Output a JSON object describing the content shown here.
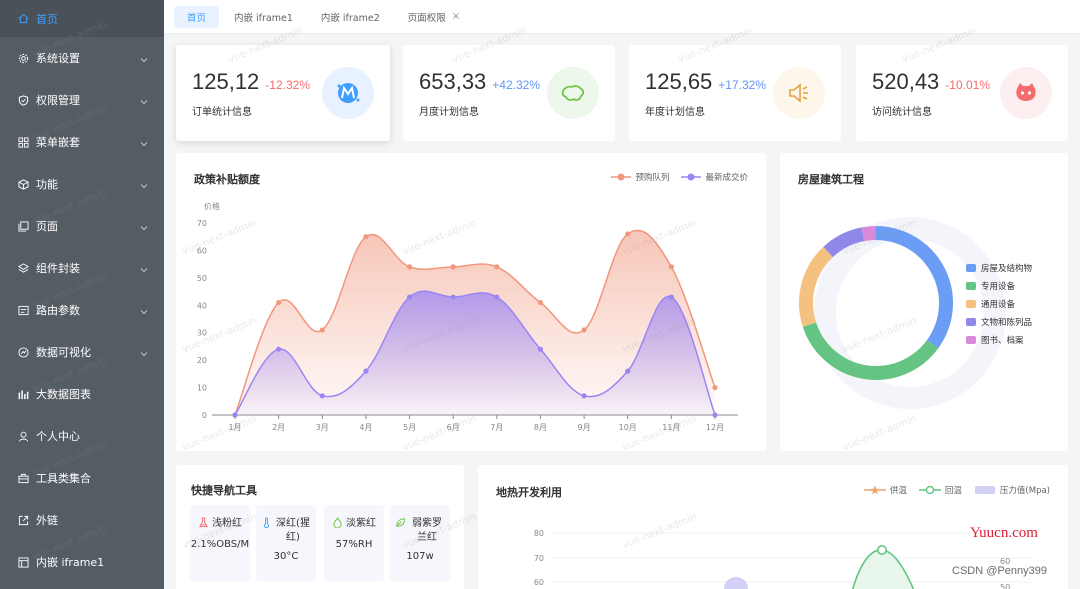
{
  "sidebar": {
    "items": [
      {
        "label": "首页",
        "icon": "home-icon",
        "active": true
      },
      {
        "label": "系统设置",
        "icon": "gear-icon",
        "caret": true
      },
      {
        "label": "权限管理",
        "icon": "shield-icon",
        "caret": true
      },
      {
        "label": "菜单嵌套",
        "icon": "grid-icon",
        "caret": true
      },
      {
        "label": "功能",
        "icon": "cube-icon",
        "caret": true
      },
      {
        "label": "页面",
        "icon": "page-icon",
        "caret": true
      },
      {
        "label": "组件封装",
        "icon": "components-icon",
        "caret": true
      },
      {
        "label": "路由参数",
        "icon": "route-icon",
        "caret": true
      },
      {
        "label": "数据可视化",
        "icon": "chart-icon",
        "caret": true
      },
      {
        "label": "大数据图表",
        "icon": "bar-chart-icon"
      },
      {
        "label": "个人中心",
        "icon": "user-icon"
      },
      {
        "label": "工具类集合",
        "icon": "toolbox-icon"
      },
      {
        "label": "外链",
        "icon": "external-link-icon"
      },
      {
        "label": "内嵌 iframe1",
        "icon": "iframe-icon"
      }
    ]
  },
  "tabs": [
    {
      "label": "首页",
      "active": true
    },
    {
      "label": "内嵌 iframe1"
    },
    {
      "label": "内嵌 iframe2"
    },
    {
      "label": "页面权限",
      "closable": true,
      "close_label": "×"
    }
  ],
  "stats": [
    {
      "value": "125,12",
      "pct": "-12.32%",
      "label": "订单统计信息",
      "pct_color": "#f56c6c",
      "icon": "m-logo-icon",
      "circle_color": "#e8f1ff",
      "icon_color": "#409eff"
    },
    {
      "value": "653,33",
      "pct": "+42.32%",
      "label": "月度计划信息",
      "pct_color": "#6394f9",
      "icon": "map-icon",
      "circle_color": "#edf7ec",
      "icon_color": "#67c23a"
    },
    {
      "value": "125,65",
      "pct": "+17.32%",
      "label": "年度计划信息",
      "pct_color": "#6394f9",
      "icon": "speaker-icon",
      "circle_color": "#fdf6ea",
      "icon_color": "#e6a23c"
    },
    {
      "value": "520,43",
      "pct": "-10.01%",
      "label": "访问统计信息",
      "pct_color": "#f56c6c",
      "icon": "octocat-icon",
      "circle_color": "#fdefef",
      "icon_color": "#f56c6c"
    }
  ],
  "subsidy": {
    "title": "政策补贴额度"
  },
  "housing": {
    "title": "房屋建筑工程"
  },
  "quicknav": {
    "title": "快捷导航工具",
    "items": [
      {
        "label": "浅粉红",
        "value": "2.1%OBS/M",
        "icon": "flask-icon",
        "color": "#f56c6c"
      },
      {
        "label": "深红(猩红)",
        "value": "30°C",
        "icon": "thermometer-icon",
        "color": "#409eff"
      },
      {
        "label": "淡紫红",
        "value": "57%RH",
        "icon": "droplet-icon",
        "color": "#67c23a"
      },
      {
        "label": "弱紫罗兰红",
        "value": "107w",
        "icon": "leaf-icon",
        "color": "#67c23a"
      }
    ]
  },
  "geothermal": {
    "title": "地热开发利用"
  },
  "watermark": "vue-next-admin",
  "corner": {
    "yuucn": "Yuucn.com",
    "csdn": "CSDN @Penny399"
  },
  "chart_data": [
    {
      "type": "area",
      "title": "政策补贴额度",
      "ylabel": "价格",
      "categories": [
        "1月",
        "2月",
        "3月",
        "4月",
        "5月",
        "6月",
        "7月",
        "8月",
        "9月",
        "10月",
        "11月",
        "12月"
      ],
      "ylim": [
        0,
        70
      ],
      "yticks": [
        0,
        10,
        20,
        30,
        40,
        50,
        60,
        70
      ],
      "legend_position": "top-right",
      "series": [
        {
          "name": "预购队列",
          "color": "#f0977d",
          "values": [
            0,
            41,
            31,
            65,
            54,
            54,
            54,
            41,
            31,
            66,
            54,
            10
          ]
        },
        {
          "name": "最新成交价",
          "color": "#9b85f4",
          "values": [
            0,
            24,
            7,
            16,
            43,
            43,
            43,
            24,
            7,
            16,
            43,
            0
          ]
        }
      ]
    },
    {
      "type": "pie",
      "title": "房屋建筑工程",
      "legend_position": "right",
      "slices": [
        {
          "name": "房屋及结构物",
          "value": 35,
          "color": "#6c9df5"
        },
        {
          "name": "专用设备",
          "value": 35,
          "color": "#65c483"
        },
        {
          "name": "通用设备",
          "value": 18,
          "color": "#f3c281"
        },
        {
          "name": "文物和陈列品",
          "value": 9,
          "color": "#9088e9"
        },
        {
          "name": "图书、档案",
          "value": 3,
          "color": "#d88ad9"
        }
      ]
    },
    {
      "type": "line",
      "title": "地热开发利用",
      "legend_position": "top-right",
      "y_left_ticks": [
        60,
        70,
        80
      ],
      "y_right_ticks": [
        50,
        60
      ],
      "series": [
        {
          "name": "供温",
          "color": "#f3a46d"
        },
        {
          "name": "回温",
          "color": "#65c483"
        },
        {
          "name": "压力值(Mpa)",
          "color": "#d3d0f6"
        }
      ]
    }
  ]
}
